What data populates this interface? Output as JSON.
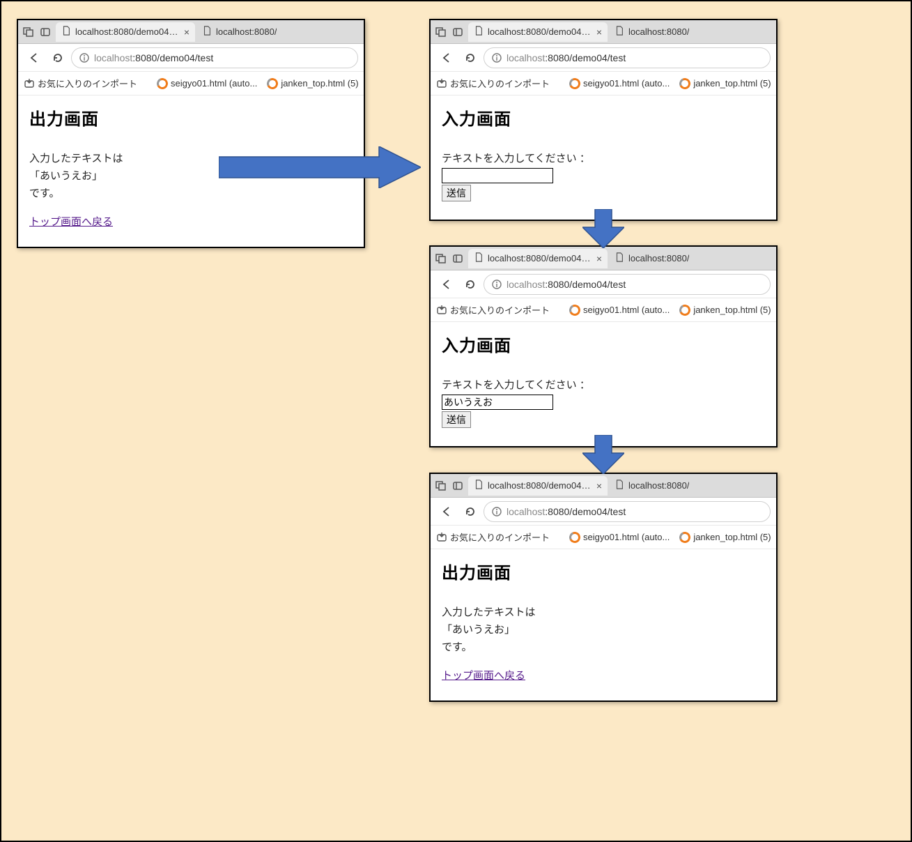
{
  "browser": {
    "tab_active_label": "localhost:8080/demo04/test",
    "tab_inactive_label": "localhost:8080/",
    "url_host": "localhost",
    "url_port_path": ":8080/demo04/test",
    "bookmarks": {
      "import": "お気に入りのインポート",
      "b1": "seigyo01.html (auto...",
      "b2": "janken_top.html (5)"
    }
  },
  "output": {
    "heading": "出力画面",
    "line1": "入力したテキストは",
    "line2": "「あいうえお」",
    "line3": "です。",
    "back_link": "トップ画面へ戻る"
  },
  "input": {
    "heading": "入力画面",
    "prompt": "テキストを入力してください ：",
    "submit": "送信",
    "filled_value": "あいうえお"
  }
}
